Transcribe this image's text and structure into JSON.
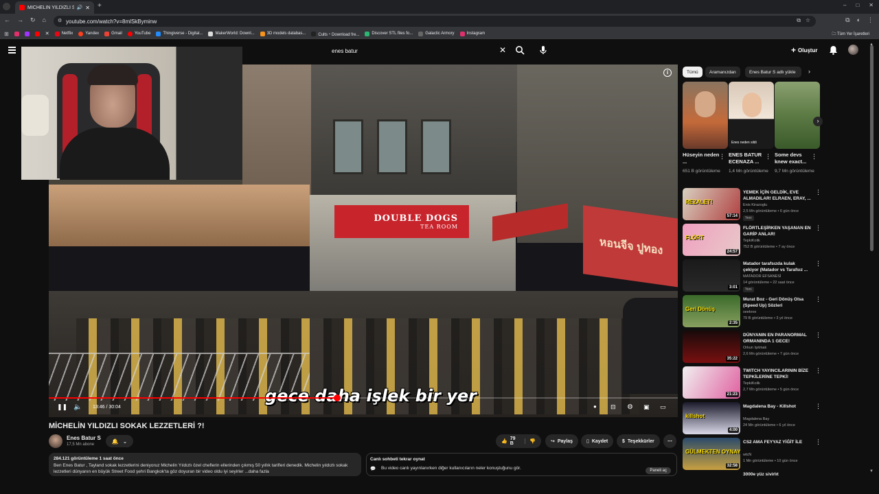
{
  "browser": {
    "tab_title": "MİCHELİN YILDIZLI SOKAK",
    "url": "youtube.com/watch?v=8mlSkByminw",
    "bookmarks": [
      "Netflix",
      "Yandex",
      "Gmail",
      "YouTube",
      "Thingiverse - Digital...",
      "MakerWorld: Downl...",
      "3D models databas...",
      "Cults・Download fre...",
      "Discover STL files fo...",
      "Galactic Armory",
      "Instagram"
    ],
    "bookmarks_right": "Tüm Yer İşaretleri"
  },
  "header": {
    "search_query": "enes batur",
    "create_label": "Oluştur"
  },
  "player": {
    "subtitle": "gece daha işlek bir yer",
    "time_current": "13:46",
    "time_total": "30:04",
    "time_display": "13:46 / 30:04",
    "progress": 0.458,
    "sign_main": "DOUBLE DOGS",
    "sign_sub": "TEA ROOM",
    "sign_thai": "หอนจีจ ปูทอง"
  },
  "video": {
    "title": "MİCHELİN YILDIZLI SOKAK LEZZETLERİ ?!",
    "channel": "Enes Batur S",
    "subscribers": "17,5 Mn abone",
    "likes": "79 B",
    "share": "Paylaş",
    "save": "Kaydet",
    "thanks": "Teşekkürler",
    "views_date": "284.121 görüntüleme  1 saat önce",
    "description": "Ben Enes Batur , Tayland sokak lezzetlerini deniyoruz Michelin Yıldızlı özel cheflerin ellerinden çıkmış 50 yıllık tarifleri denedik. Michelin yıldızlı sokak lezzetleri dünyanın en büyük Street Food şehri Bangkok'ta göz doyuran bir video oldu iyi seyirler ...daha fazla",
    "chat_title": "Canlı sohbeti tekrar oynat",
    "chat_desc": "Bu video canlı yayınlanırken diğer kullanıcıların neler konuştuğunu gör.",
    "chat_button": "Paneli aç"
  },
  "sidebar": {
    "chips": [
      "Tümü",
      "Aramanızdan",
      "Enes Batur S adlı yükle"
    ],
    "shorts": [
      {
        "title": "Hüseyin neden ...",
        "views": "651 B görüntüleme"
      },
      {
        "title": "ENES BATUR ECENAZA ...",
        "views": "1,4 Mn görüntüleme",
        "overlay": "Enes neden sildi"
      },
      {
        "title": "Some devs knew exact...",
        "views": "9,7 Mn görüntüleme"
      }
    ],
    "recommendations": [
      {
        "title": "YEMEK İÇİN GELDİK, EVE ALMADILAR! ELRAEN, ERAY, ...",
        "channel": "Enis Kirazoglu",
        "meta": "2,5 Mn görüntüleme • 6 gün önce",
        "badge": "Yeni",
        "duration": "57:14",
        "thumb_text": "REZALET!"
      },
      {
        "title": "FLÖRTLEŞİRKEN YAŞANAN EN GARİP ANLAR!",
        "channel": "TepkiKolik",
        "meta": "752 B görüntüleme • 7 ay önce",
        "badge": "",
        "duration": "24:57",
        "thumb_text": "FLÖRT"
      },
      {
        "title": "Matador tarafsızda kulak çekiyor (Matador vs Tarafsız ...",
        "channel": "MATADOR EFSANESİ",
        "meta": "14 görüntüleme • 22 saat önce",
        "badge": "Yeni",
        "duration": "3:01",
        "thumb_text": ""
      },
      {
        "title": "Murat Boz - Geri Dönüş Olsa (Speed Up) Sözleri",
        "channel": "seekrox",
        "meta": "79 B görüntüleme • 3 yıl önce",
        "badge": "",
        "duration": "2:35",
        "thumb_text": "Geri Dönüş"
      },
      {
        "title": "DÜNYANIN EN PARANORMAL ORMANINDA 1 GECE!",
        "channel": "Orkun Işıtmak",
        "meta": "2,6 Mn görüntüleme • 7 gün önce",
        "badge": "",
        "duration": "35:22",
        "thumb_text": ""
      },
      {
        "title": "TWITCH YAYINCILARININ BİZE TEPKİLERİNE TEPKİ!",
        "channel": "TepkiKolik",
        "meta": "2,7 Mn görüntüleme • 5 gün önce",
        "badge": "",
        "duration": "21:23",
        "thumb_text": ""
      },
      {
        "title": "Magdalena Bay - Killshot",
        "channel": "Magdalena Bay",
        "meta": "24 Mn görüntüleme • 6 yıl önce",
        "badge": "",
        "duration": "4:00",
        "thumb_text": "killshot"
      },
      {
        "title": "CS2 AMA FEYYAZ YİĞİT İLE",
        "channel": "wtcN",
        "meta": "1 Mn görüntüleme • 10 gün önce",
        "badge": "",
        "duration": "32:58",
        "thumb_text": "GÜLMEKTEN OYNAYAMADIK"
      }
    ],
    "partial_title": "3000e yüz sivirlıt"
  },
  "colors": {
    "brand_red": "#ff0000",
    "bg": "#0f0f0f",
    "pill": "#272727"
  }
}
